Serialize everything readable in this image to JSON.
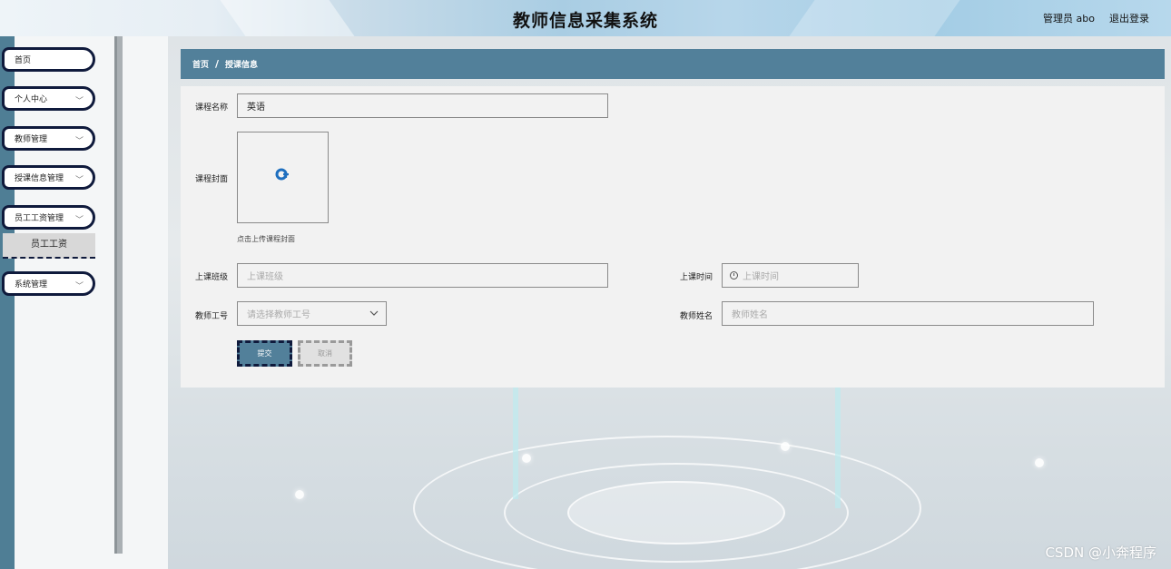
{
  "header": {
    "title": "教师信息采集系统",
    "user_label": "管理员 abo",
    "logout_label": "退出登录"
  },
  "sidebar": {
    "items": [
      {
        "label": "首页"
      },
      {
        "label": "个人中心"
      },
      {
        "label": "教师管理"
      },
      {
        "label": "授课信息管理"
      },
      {
        "label": "员工工资管理"
      },
      {
        "label": "系统管理"
      }
    ],
    "sub_item": {
      "label": "员工工资"
    },
    "chevron": "﹀"
  },
  "breadcrumb": {
    "home": "首页",
    "separator": "/",
    "current": "授课信息"
  },
  "form": {
    "course_name": {
      "label": "课程名称",
      "value": "英语"
    },
    "course_cover": {
      "label": "课程封面",
      "hint": "点击上传课程封面"
    },
    "class_name": {
      "label": "上课班级",
      "placeholder": "上课班级"
    },
    "class_time": {
      "label": "上课时间",
      "placeholder": "上课时间"
    },
    "teacher_id": {
      "label": "教师工号",
      "placeholder": "请选择教师工号"
    },
    "teacher_name": {
      "label": "教师姓名",
      "placeholder": "教师姓名"
    },
    "submit_label": "提交",
    "cancel_label": "取消"
  },
  "watermark": "CSDN @小奔程序",
  "colors": {
    "accent": "#52809a",
    "border_dark": "#0f1a3c",
    "icon_blue": "#1e6fbf"
  },
  "icons": {
    "upload": "plus-icon",
    "clock": "clock-icon",
    "select": "chevron-down-icon"
  }
}
